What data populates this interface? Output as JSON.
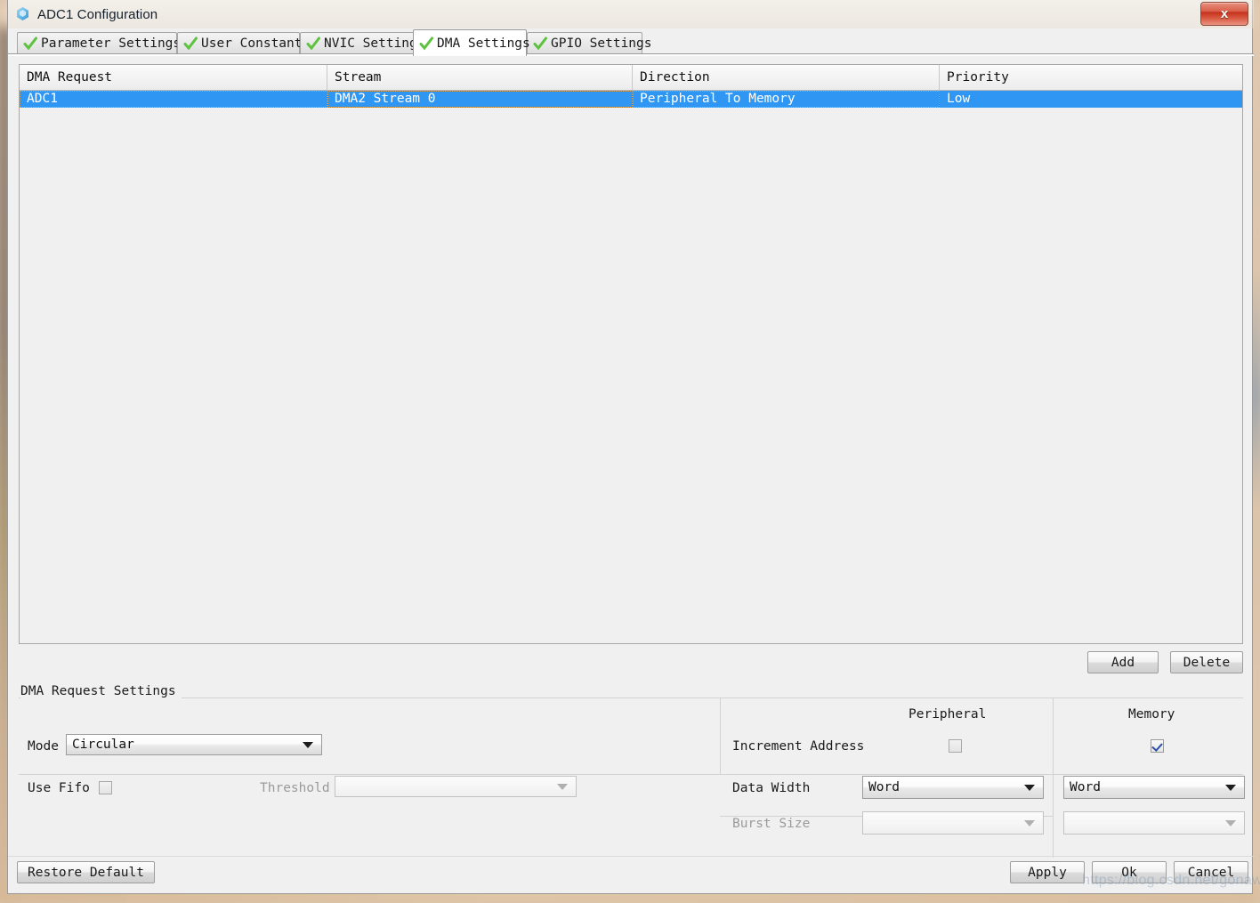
{
  "window": {
    "title": "ADC1 Configuration",
    "icon": "cube-icon",
    "close_label": "x"
  },
  "tabs": [
    {
      "label": "Parameter Settings",
      "icon": "green-check-icon",
      "active": false
    },
    {
      "label": "User Constants",
      "icon": "green-check-icon",
      "active": false
    },
    {
      "label": "NVIC Settings",
      "icon": "green-check-icon",
      "active": false
    },
    {
      "label": "DMA Settings",
      "icon": "green-check-icon",
      "active": true
    },
    {
      "label": "GPIO Settings",
      "icon": "green-check-icon",
      "active": false
    }
  ],
  "table": {
    "columns": [
      "DMA Request",
      "Stream",
      "Direction",
      "Priority"
    ],
    "rows": [
      {
        "dma_request": "ADC1",
        "stream": "DMA2 Stream 0",
        "direction": "Peripheral To Memory",
        "priority": "Low",
        "selected": true
      }
    ]
  },
  "table_actions": {
    "add_label": "Add",
    "delete_label": "Delete"
  },
  "settings": {
    "group_title": "DMA Request Settings",
    "mode_label": "Mode",
    "mode_value": "Circular",
    "use_fifo_label": "Use Fifo",
    "use_fifo_checked": false,
    "threshold_label": "Threshold",
    "threshold_value": "",
    "threshold_enabled": false,
    "col_peripheral": "Peripheral",
    "col_memory": "Memory",
    "increment_address_label": "Increment Address",
    "increment_address_peripheral_checked": false,
    "increment_address_memory_checked": true,
    "data_width_label": "Data Width",
    "data_width_peripheral": "Word",
    "data_width_memory": "Word",
    "burst_size_label": "Burst Size",
    "burst_size_peripheral": "",
    "burst_size_memory": "",
    "burst_size_enabled": false
  },
  "footer": {
    "restore_label": "Restore Default",
    "apply_label": "Apply",
    "ok_label": "Ok",
    "cancel_label": "Cancel"
  },
  "watermark": "https://blog.csdn.net/gonawk",
  "colors": {
    "selection_blue": "#2f97f3",
    "dialog_bg": "#f0f0f0",
    "accent_check_green": "#4fbf3a",
    "close_red": "#c5321c"
  }
}
